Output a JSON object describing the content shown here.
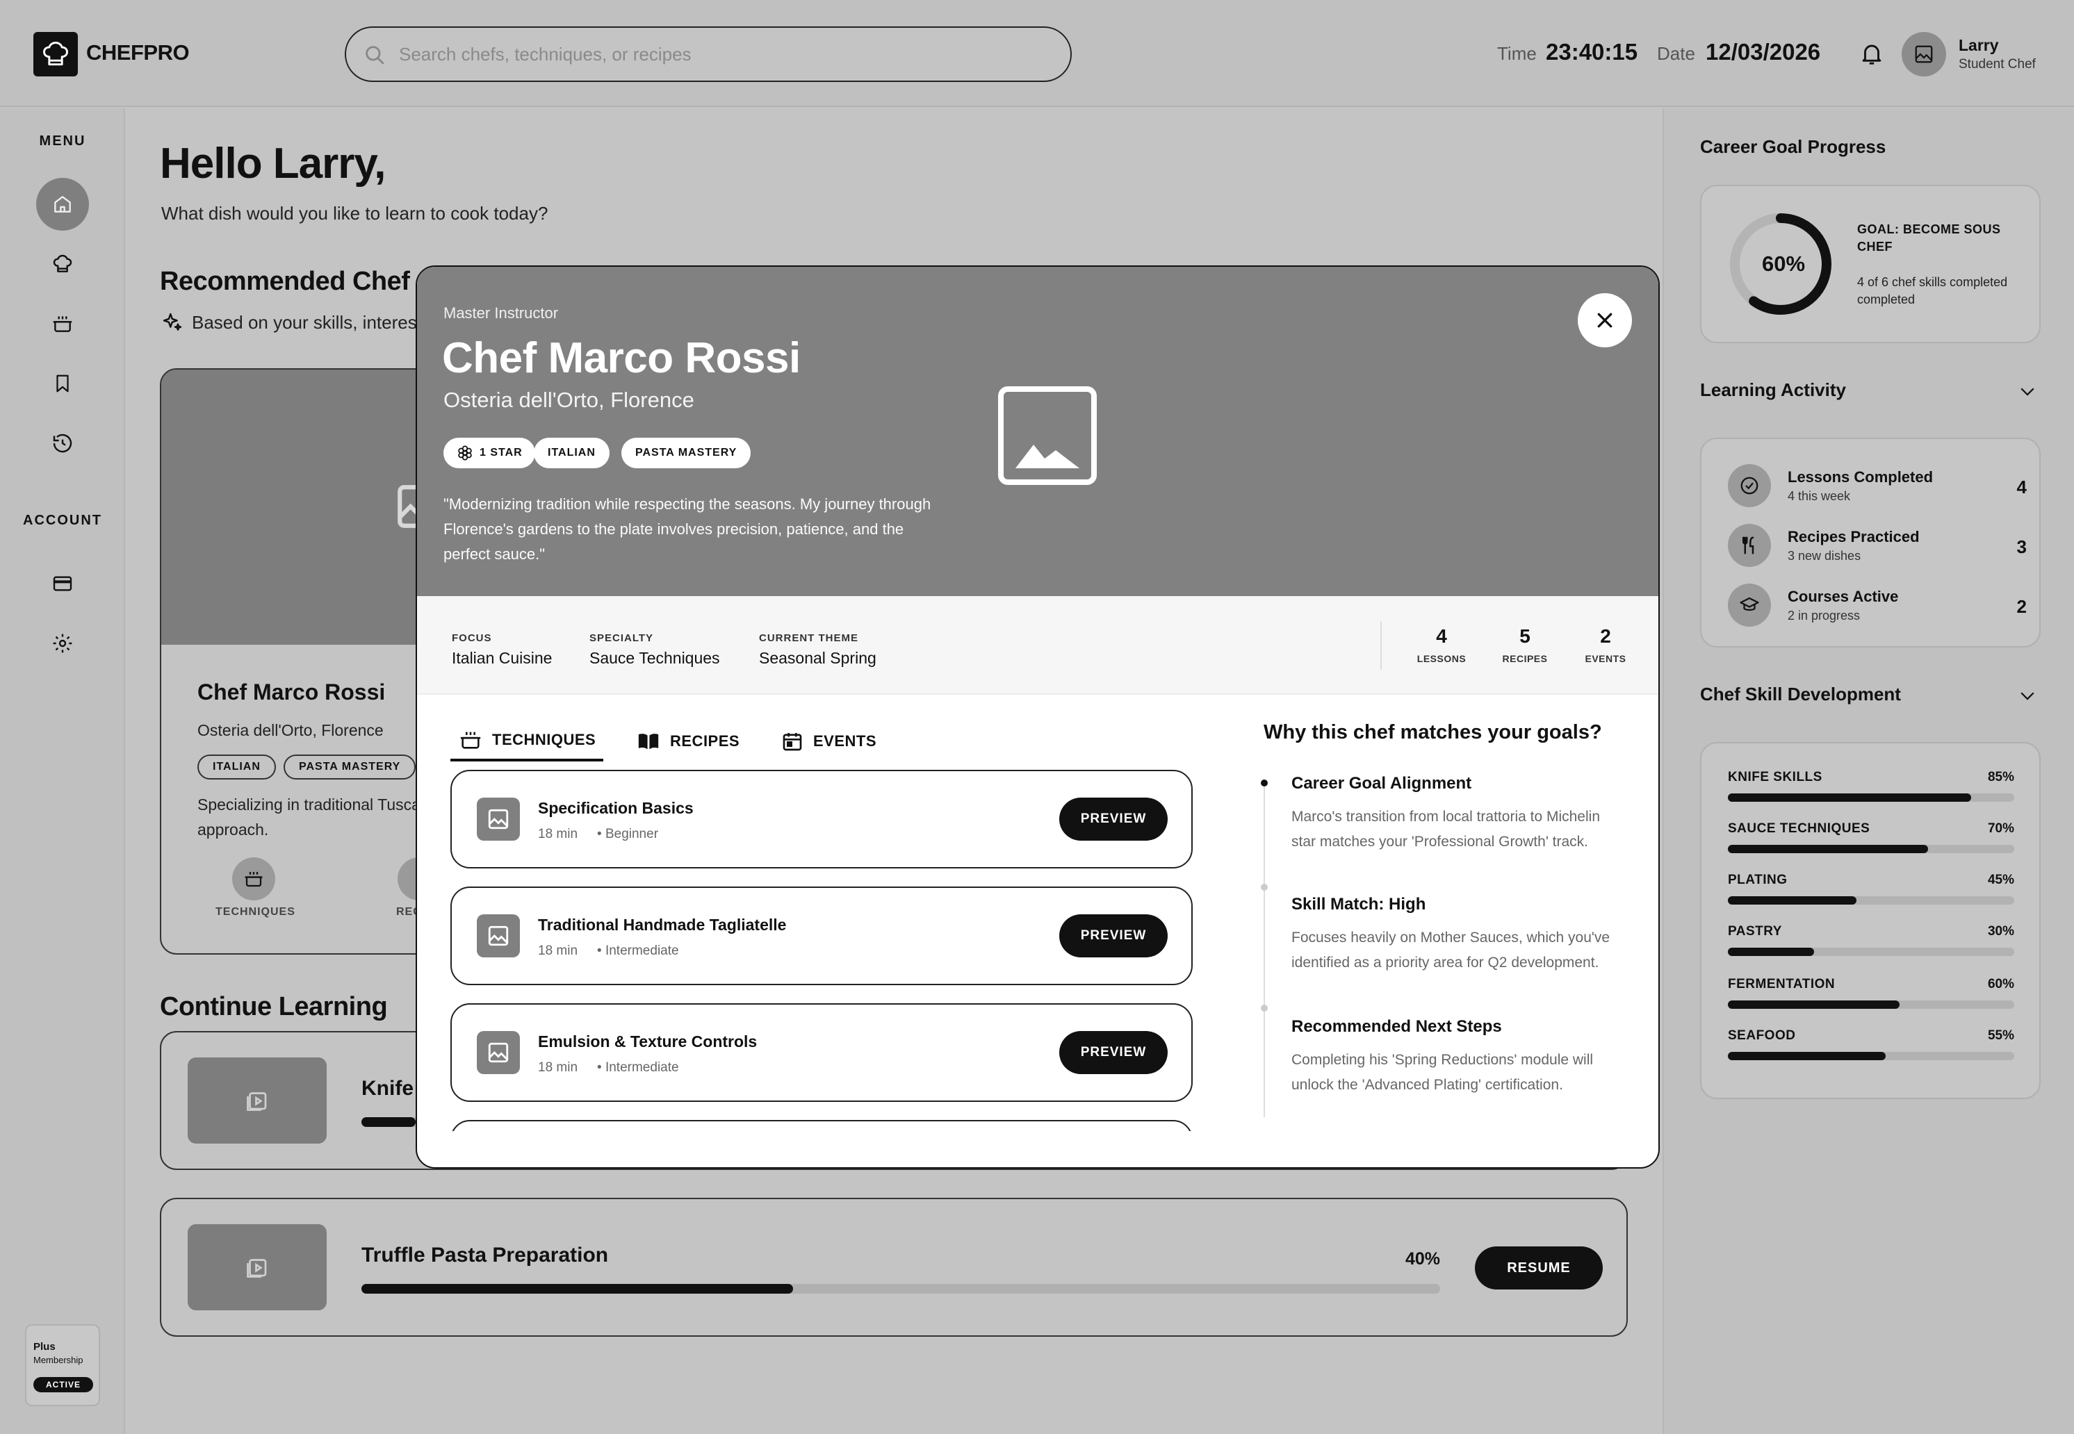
{
  "header": {
    "brand": "CHEFPRO",
    "search_placeholder": "Search chefs, techniques, or recipes",
    "time_label": "Time",
    "time_value": "23:40:15",
    "date_label": "Date",
    "date_value": "12/03/2026",
    "user_name": "Larry",
    "user_role": "Student Chef"
  },
  "sidebar": {
    "menu_label": "MENU",
    "account_label": "ACCOUNT",
    "menu_icons": [
      "home-icon",
      "chef-hat-icon",
      "pot-icon",
      "bookmark-icon",
      "history-icon"
    ],
    "account_icons": [
      "credit-card-icon",
      "gear-icon"
    ],
    "membership": {
      "line1": "Plus",
      "line2": "Membership",
      "badge": "ACTIVE"
    }
  },
  "main": {
    "greeting": "Hello Larry,",
    "subtitle": "What dish would you like to learn to cook today?",
    "recommended_title": "Recommended Chef",
    "recommended_note": "Based on your skills, interes",
    "chef_card": {
      "name": "Chef Marco Rossi",
      "location": "Osteria dell'Orto, Florence",
      "tags": [
        "ITALIAN",
        "PASTA MASTERY"
      ],
      "description": "Specializing in traditional Tusca farm-to- table approach.",
      "tab_label": "TECHNIQUES",
      "tab_label_2": "REC"
    },
    "continue_title": "Continue Learning",
    "continue_items": [
      {
        "title": "Knife",
        "progress": 0.05,
        "percent": "",
        "button": ""
      },
      {
        "title": "Truffle Pasta Preparation",
        "progress": 0.4,
        "percent": "40%",
        "button": "RESUME"
      }
    ]
  },
  "right_panel": {
    "goal_title": "Career Goal Progress",
    "goal_percent": "60%",
    "goal_progress": 0.6,
    "goal_name": "GOAL: BECOME SOUS CHEF",
    "goal_detail": "4 of 6 chef skills completed completed",
    "activity_title": "Learning Activity",
    "activity": [
      {
        "title": "Lessons Completed",
        "sub": "4 this week",
        "value": "4",
        "icon": "check-circle-icon"
      },
      {
        "title": "Recipes Practiced",
        "sub": "3 new dishes",
        "value": "3",
        "icon": "fork-knife-icon"
      },
      {
        "title": "Courses Active",
        "sub": "2 in progress",
        "value": "2",
        "icon": "graduation-cap-icon"
      }
    ],
    "skills_title": "Chef Skill Development",
    "skills": [
      {
        "name": "KNIFE SKILLS",
        "percent": "85%",
        "value": 0.85
      },
      {
        "name": "SAUCE TECHNIQUES",
        "percent": "70%",
        "value": 0.7
      },
      {
        "name": "PLATING",
        "percent": "45%",
        "value": 0.45
      },
      {
        "name": "PASTRY",
        "percent": "30%",
        "value": 0.3
      },
      {
        "name": "FERMENTATION",
        "percent": "60%",
        "value": 0.6
      },
      {
        "name": "SEAFOOD",
        "percent": "55%",
        "value": 0.55
      }
    ]
  },
  "modal": {
    "eyebrow": "Master Instructor",
    "name": "Chef Marco Rossi",
    "location": "Osteria dell'Orto, Florence",
    "tags": [
      "1 STAR",
      "ITALIAN",
      "PASTA MASTERY"
    ],
    "quote": "\"Modernizing tradition while respecting the seasons. My journey through Florence's gardens to the plate involves precision, patience, and the perfect sauce.\"",
    "stats": [
      {
        "label": "FOCUS",
        "value": "Italian Cuisine"
      },
      {
        "label": "SPECIALTY",
        "value": "Sauce Techniques"
      },
      {
        "label": "CURRENT THEME",
        "value": "Seasonal Spring"
      }
    ],
    "counts": [
      {
        "value": "4",
        "label": "LESSONS"
      },
      {
        "value": "5",
        "label": "RECIPES"
      },
      {
        "value": "2",
        "label": "EVENTS"
      }
    ],
    "tabs": [
      {
        "label": "TECHNIQUES",
        "icon": "pot-icon"
      },
      {
        "label": "RECIPES",
        "icon": "book-open-icon"
      },
      {
        "label": "EVENTS",
        "icon": "calendar-icon"
      }
    ],
    "techniques": [
      {
        "title": "Specification Basics",
        "duration": "18 min",
        "level": "• Beginner",
        "button": "PREVIEW"
      },
      {
        "title": "Traditional Handmade Tagliatelle",
        "duration": "18 min",
        "level": "• Intermediate",
        "button": "PREVIEW"
      },
      {
        "title": "Emulsion & Texture Controls",
        "duration": "18 min",
        "level": "• Intermediate",
        "button": "PREVIEW"
      }
    ],
    "why_title": "Why this chef matches your goals?",
    "why_items": [
      {
        "title": "Career Goal Alignment",
        "text": "Marco's transition from local trattoria to Michelin star matches your 'Professional Growth' track."
      },
      {
        "title": "Skill Match: High",
        "text": "Focuses heavily on Mother Sauces, which you've identified as a priority area for Q2 development."
      },
      {
        "title": "Recommended Next Steps",
        "text": "Completing his 'Spring Reductions' module will unlock the 'Advanced Plating' certification."
      }
    ]
  }
}
